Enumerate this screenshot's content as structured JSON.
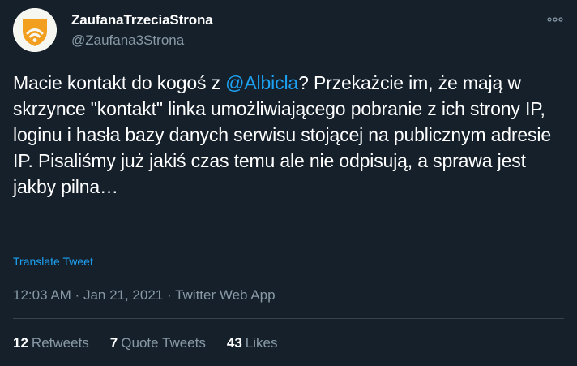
{
  "author": {
    "display_name": "ZaufanaTrzeciaStrona",
    "handle": "@Zaufana3Strona",
    "avatar_icon": "shield-wifi-logo"
  },
  "tweet": {
    "text_before": "Macie kontakt do kogoś z ",
    "mention": "@Albicla",
    "text_after": "? Przekażcie im, że mają w skrzynce \"kontakt\" linka umożliwiającego pobranie z ich strony IP, loginu i hasła bazy danych serwisu stojącej na publicznym adresie IP. Pisaliśmy już jakiś czas temu ale nie odpisują, a sprawa jest jakby pilna…",
    "translate_label": "Translate Tweet"
  },
  "meta": {
    "time": "12:03 AM",
    "separator1": " · ",
    "date": "Jan 21, 2021",
    "separator2": " · ",
    "source": "Twitter Web App"
  },
  "stats": {
    "retweets_count": "12",
    "retweets_label": "Retweets",
    "quotes_count": "7",
    "quotes_label": "Quote Tweets",
    "likes_count": "43",
    "likes_label": "Likes"
  },
  "colors": {
    "background": "#15202b",
    "accent": "#1da1f2",
    "secondary_text": "#8899a6",
    "divider": "#38444d",
    "logo_orange": "#f29f1f"
  }
}
